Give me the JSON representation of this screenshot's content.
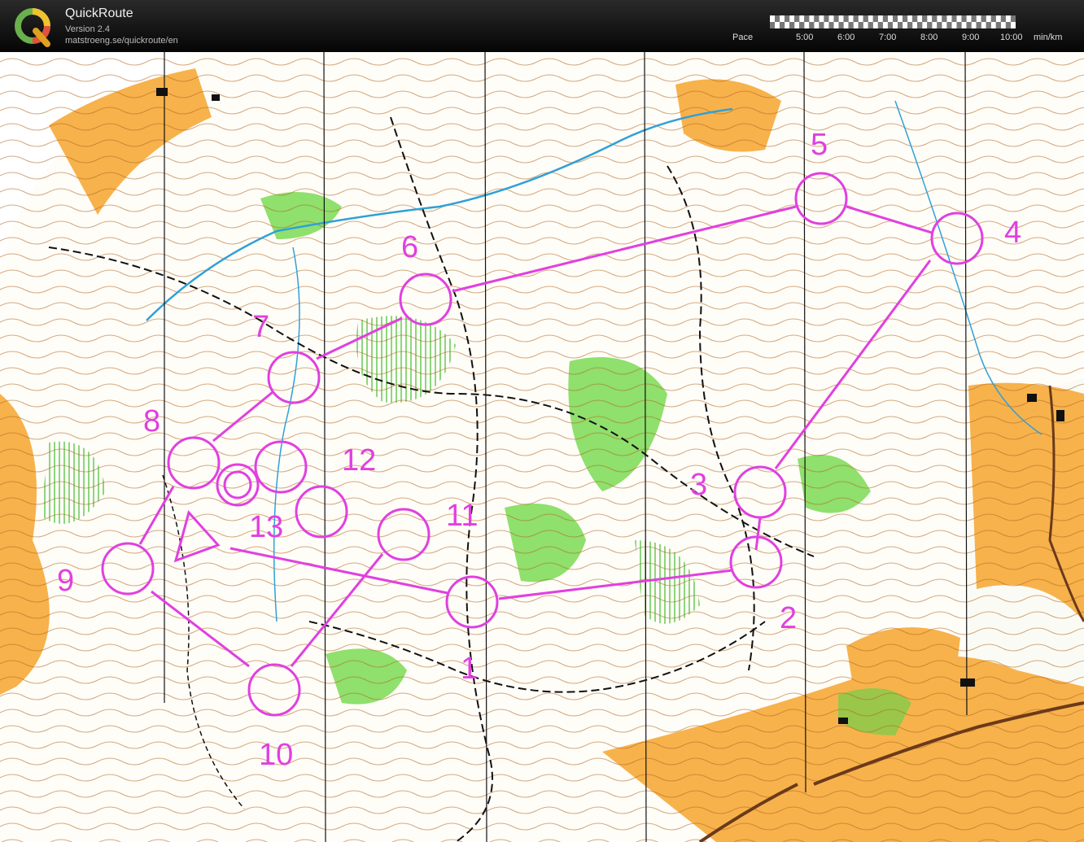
{
  "app": {
    "name": "QuickRoute",
    "version": "Version 2.4",
    "url": "matstroeng.se/quickroute/en"
  },
  "pace_scale": {
    "label": "Pace",
    "ticks": [
      "5:00",
      "6:00",
      "7:00",
      "8:00",
      "9:00",
      "10:00"
    ],
    "unit": "min/km"
  },
  "course": {
    "color": "#e040e0",
    "controls": [
      "1",
      "2",
      "3",
      "4",
      "5",
      "6",
      "7",
      "8",
      "9",
      "10",
      "11",
      "12",
      "13"
    ]
  },
  "map_colors": {
    "open_land": "#f7b24c",
    "forest_green": "#7ed95a",
    "contour": "#b0651e",
    "water": "#2fa0d8"
  }
}
